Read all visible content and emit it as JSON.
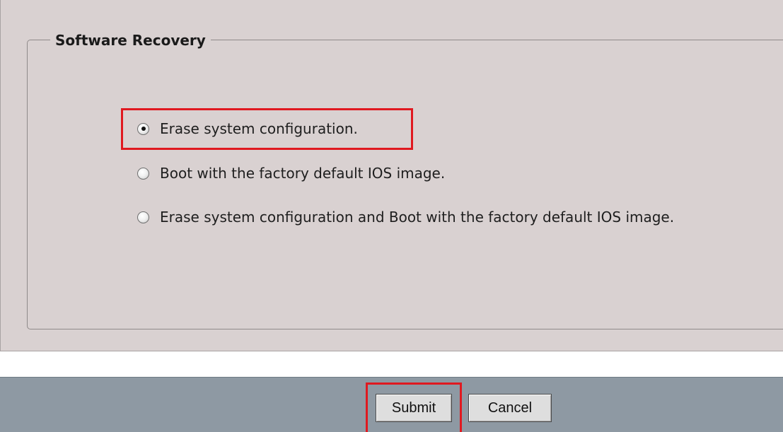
{
  "fieldset": {
    "legend": "Software Recovery"
  },
  "options": [
    {
      "label": "Erase system configuration.",
      "selected": true
    },
    {
      "label": "Boot with the factory default IOS image.",
      "selected": false
    },
    {
      "label": "Erase system configuration and Boot with the factory default IOS image.",
      "selected": false
    }
  ],
  "buttons": {
    "submit": "Submit",
    "cancel": "Cancel"
  },
  "colors": {
    "panel_background": "#d9d1d1",
    "footer_background": "#8e99a3",
    "highlight": "#e01920"
  }
}
